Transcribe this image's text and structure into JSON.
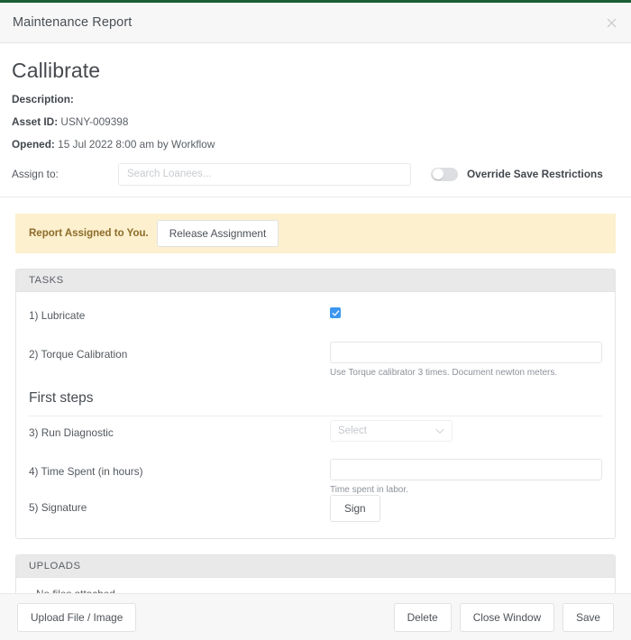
{
  "window": {
    "title": "Maintenance Report",
    "close_icon": "close-icon"
  },
  "report": {
    "title": "Callibrate",
    "description_label": "Description:",
    "description_value": "",
    "asset_id_label": "Asset ID:",
    "asset_id_value": "USNY-009398",
    "opened_label": "Opened:",
    "opened_value": "15 Jul 2022 8:00 am by Workflow",
    "assign_label": "Assign to:",
    "assign_placeholder": "Search Loanees...",
    "assign_value": "",
    "override_toggle_label": "Override Save Restrictions",
    "override_toggle_state": "off"
  },
  "banner": {
    "text": "Report Assigned to You.",
    "button_label": "Release Assignment",
    "background": "#fcf0ce",
    "text_color": "#8d6b2a"
  },
  "tasks_card": {
    "header": "TASKS",
    "items": [
      {
        "label": "1) Lubricate",
        "type": "checkbox",
        "checked": true,
        "hint": ""
      },
      {
        "label": "2) Torque Calibration",
        "type": "text",
        "value": "",
        "hint": "Use Torque calibrator 3 times. Document newton meters."
      }
    ],
    "group_title": "First steps",
    "group_items": [
      {
        "label": "3) Run Diagnostic",
        "type": "select",
        "value": "Select",
        "hint": ""
      },
      {
        "label": "4) Time Spent (in hours)",
        "type": "text",
        "value": "",
        "hint": "Time spent in labor."
      },
      {
        "label": "5) Signature",
        "type": "button",
        "value": "Sign",
        "hint": ""
      }
    ]
  },
  "uploads_card": {
    "header": "UPLOADS",
    "empty_text": "No files attached..."
  },
  "footer": {
    "upload_label": "Upload File / Image",
    "delete_label": "Delete",
    "close_label": "Close Window",
    "save_label": "Save"
  },
  "theme": {
    "accent_green": "#1b5e34",
    "checkbox_blue": "#3c97f1",
    "header_grey": "#e9e9e9"
  }
}
